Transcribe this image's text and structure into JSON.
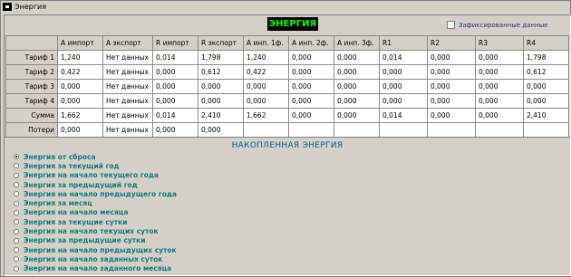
{
  "window": {
    "title": "Энергия"
  },
  "banner": "ЭНЕРГИЯ",
  "fixed_data": {
    "label": "Зафиксированные  данные",
    "checked": false
  },
  "table": {
    "headers": [
      "",
      "А импорт",
      "А экспорт",
      "R импорт",
      "R экспорт",
      "А инп. 1ф.",
      "А инп. 2ф.",
      "А инп. 3ф.",
      "R1",
      "R2",
      "R3",
      "R4"
    ],
    "rows": [
      {
        "label": "Тариф 1",
        "cells": [
          "1,240",
          "Нет данных",
          "0,014",
          "1,798",
          "1,240",
          "0,000",
          "0,000",
          "0,014",
          "0,000",
          "0,000",
          "1,798"
        ]
      },
      {
        "label": "Тариф 2",
        "cells": [
          "0,422",
          "Нет данных",
          "0,000",
          "0,612",
          "0,422",
          "0,000",
          "0,000",
          "0,000",
          "0,000",
          "0,000",
          "0,612"
        ]
      },
      {
        "label": "Тариф 3",
        "cells": [
          "0,000",
          "Нет данных",
          "0,000",
          "0,000",
          "0,000",
          "0,000",
          "0,000",
          "0,000",
          "0,000",
          "0,000",
          "0,000"
        ]
      },
      {
        "label": "Тариф 4",
        "cells": [
          "0,000",
          "Нет данных",
          "0,000",
          "0,000",
          "0,000",
          "0,000",
          "0,000",
          "0,000",
          "0,000",
          "0,000",
          "0,000"
        ]
      },
      {
        "label": "Сумма",
        "cells": [
          "1,662",
          "Нет данных",
          "0,014",
          "2,410",
          "1,662",
          "0,000",
          "0,000",
          "0,014",
          "0,000",
          "0,000",
          "2,410"
        ]
      },
      {
        "label": "Потери",
        "cells": [
          "0,000",
          "Нет данных",
          "0,000",
          "0,000",
          "",
          "",
          "",
          "",
          "",
          "",
          ""
        ]
      }
    ]
  },
  "accumulated": {
    "title": "НАКОПЛЕННАЯ ЭНЕРГИЯ",
    "options": [
      {
        "label": "Энергия от сброса",
        "selected": true
      },
      {
        "label": "Энергия за текущий год",
        "selected": false
      },
      {
        "label": "Энергия на начало текущего года",
        "selected": false
      },
      {
        "label": "Энергия за предыдущий год",
        "selected": false
      },
      {
        "label": "Энергия на начало предыдущего года",
        "selected": false
      },
      {
        "label": "Энергия за месяц",
        "selected": false
      },
      {
        "label": "Энергия на начало месяца",
        "selected": false
      },
      {
        "label": "Энергия за текущие сутки",
        "selected": false
      },
      {
        "label": "Энергия на начало текущих суток",
        "selected": false
      },
      {
        "label": "Энергия за предыдущие сутки",
        "selected": false
      },
      {
        "label": "Энергия на начало предыдущих суток",
        "selected": false
      },
      {
        "label": "Энергия на начало заданных суток",
        "selected": false
      },
      {
        "label": "Энергия на начало заданного месяца",
        "selected": false
      }
    ]
  }
}
